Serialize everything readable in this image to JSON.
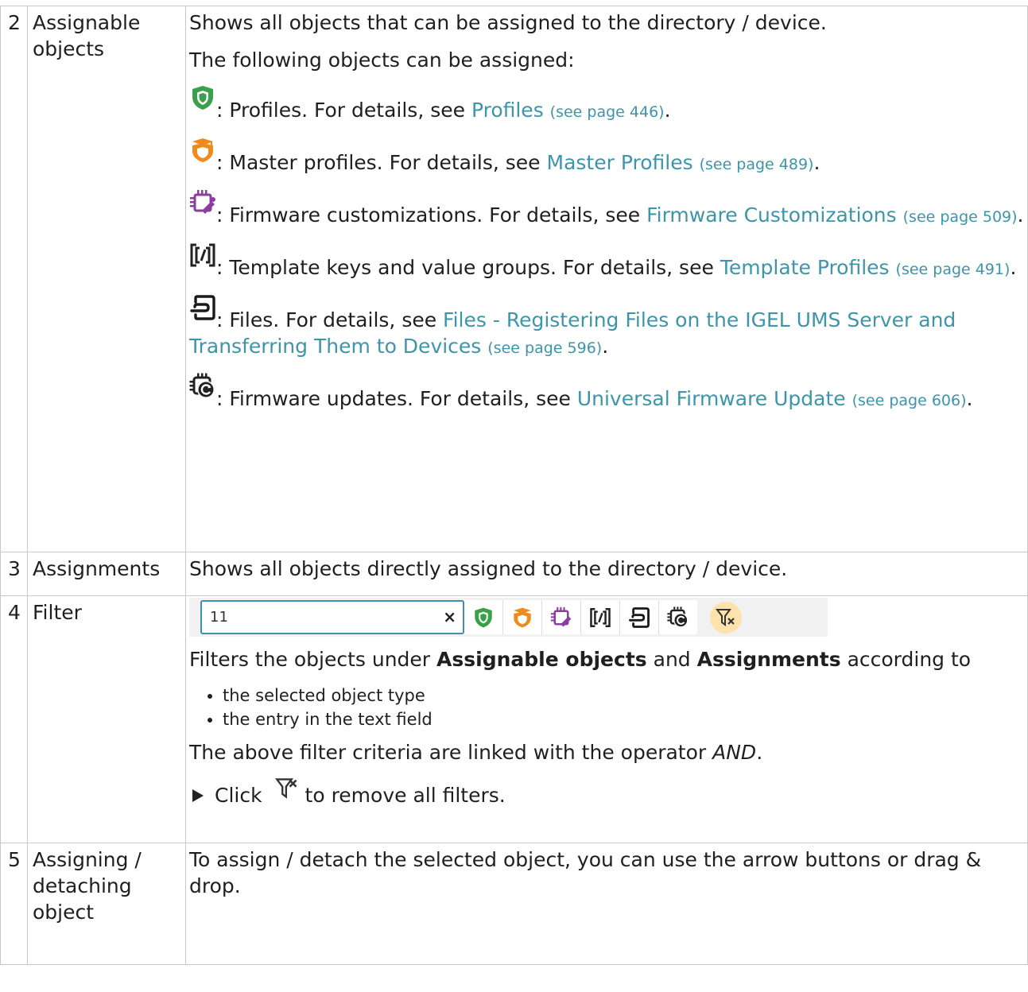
{
  "rows": [
    {
      "num": "2",
      "name": "Assignable objects",
      "intro": "Shows all objects that can be assigned to the directory / device.",
      "following": "The following objects can be assigned:",
      "items": [
        {
          "icon": "profile-shield-icon",
          "text": ": Profiles. For details, see ",
          "link": "Profiles",
          "page": "(see page 446)",
          "after": "."
        },
        {
          "icon": "master-profile-icon",
          "text": ": Master profiles. For details, see ",
          "link": "Master Profiles",
          "page": "(see page 489)",
          "after": "."
        },
        {
          "icon": "firmware-customization-icon",
          "text": ": Firmware customizations. For details, see ",
          "link": "Firmware Customizations",
          "page": "(see page 509)",
          "after": "."
        },
        {
          "icon": "template-keys-icon",
          "text": ": Template keys and value groups. For details, see ",
          "link": "Template Profiles",
          "page": "(see page 491)",
          "after": "."
        },
        {
          "icon": "files-icon",
          "text": ": Files. For details, see ",
          "link": "Files - Registering Files on the IGEL UMS Server and Transferring Them to Devices",
          "page": "(see page 596)",
          "after": "."
        },
        {
          "icon": "firmware-update-icon",
          "text": ": Firmware updates. For details, see ",
          "link": "Universal Firmware Update",
          "page": "(see page 606)",
          "after": "."
        }
      ]
    },
    {
      "num": "3",
      "name": "Assignments",
      "desc": "Shows all objects directly assigned to the directory / device."
    },
    {
      "num": "4",
      "name": "Filter",
      "search_value": "11",
      "clear_symbol": "×",
      "filter_text_1": "Filters the objects under ",
      "filter_bold_1": "Assignable objects",
      "filter_text_2": " and ",
      "filter_bold_2": "Assignments",
      "filter_text_3": " according to",
      "bullets": [
        "the selected object type",
        "the entry in the text field"
      ],
      "operator_text": "The above filter criteria are linked with the operator ",
      "operator": "AND",
      "operator_end": ".",
      "click_text": "Click",
      "click_after": "to remove all filters."
    },
    {
      "num": "5",
      "name": "Assigning / detaching object",
      "desc": "To assign / detach the selected object, you can use the arrow buttons or drag & drop."
    }
  ],
  "colors": {
    "link": "#3d95a9",
    "profile_green": "#3aa04a",
    "master_orange": "#f08a1c",
    "firmware_purple": "#8a3f9c",
    "clear_filter_bg": "#fde2ac"
  }
}
